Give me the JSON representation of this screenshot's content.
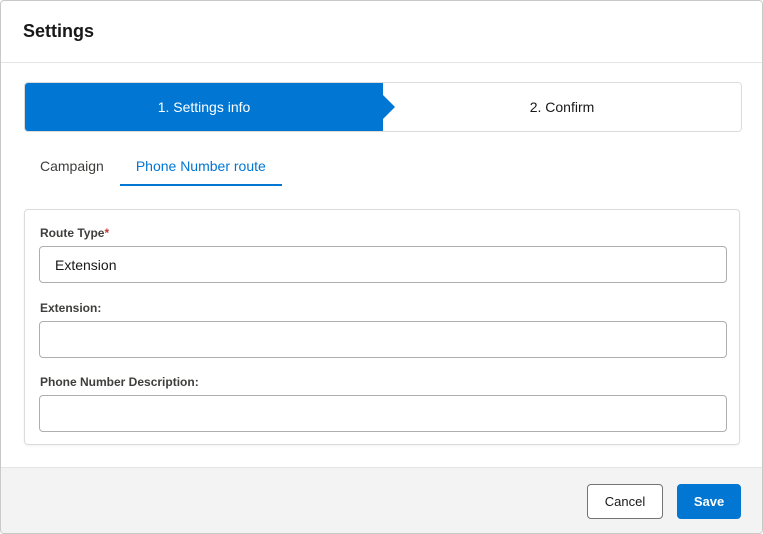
{
  "dialog": {
    "title": "Settings"
  },
  "path": {
    "steps": [
      {
        "label": "1. Settings info",
        "state": "active"
      },
      {
        "label": "2. Confirm",
        "state": "inactive"
      }
    ]
  },
  "tabs": [
    {
      "label": "Campaign",
      "active": false
    },
    {
      "label": "Phone Number route",
      "active": true
    }
  ],
  "form": {
    "route_type": {
      "label": "Route Type",
      "required_mark": "*",
      "value": "Extension"
    },
    "extension": {
      "label": "Extension:",
      "value": ""
    },
    "phone_description": {
      "label": "Phone Number Description:",
      "value": ""
    }
  },
  "footer": {
    "cancel_label": "Cancel",
    "save_label": "Save"
  },
  "colors": {
    "accent": "#0176d3",
    "required": "#c23934"
  }
}
